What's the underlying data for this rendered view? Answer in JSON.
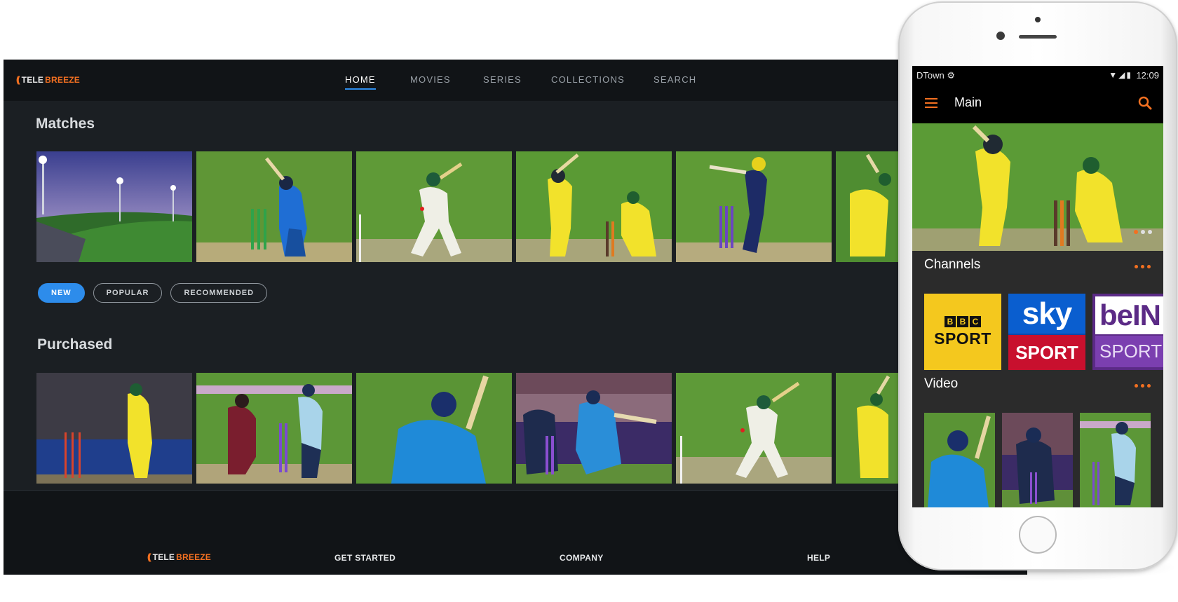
{
  "desktop": {
    "brand": {
      "wave": "((",
      "tele": "TELE",
      "breeze": "BREEZE"
    },
    "nav": [
      {
        "label": "HOME",
        "active": true
      },
      {
        "label": "MOVIES",
        "active": false
      },
      {
        "label": "SERIES",
        "active": false
      },
      {
        "label": "COLLECTIONS",
        "active": false
      },
      {
        "label": "SEARCH",
        "active": false
      }
    ],
    "sections": {
      "matches": "Matches",
      "purchased": "Purchased"
    },
    "filters": [
      {
        "label": "NEW",
        "active": true
      },
      {
        "label": "POPULAR",
        "active": false
      },
      {
        "label": "RECOMMENDED",
        "active": false
      }
    ],
    "footer": {
      "links": [
        "GET STARTED",
        "COMPANY",
        "HELP"
      ]
    },
    "colors": {
      "accent": "#2d8ceb",
      "brand": "#f37021",
      "background": "#1b1f23",
      "bar": "#111417"
    }
  },
  "phone": {
    "status": {
      "carrier": "DTown ⚙",
      "icons": "▼◢▮",
      "time": "12:09"
    },
    "appbar": {
      "title": "Main"
    },
    "sections": {
      "channels": "Channels",
      "video": "Video"
    },
    "channels": {
      "bbc": {
        "blocks": [
          "B",
          "B",
          "C"
        ],
        "word": "SPORT"
      },
      "sky": {
        "top": "sky",
        "bottom": "SPORT"
      },
      "bein": {
        "top": "beIN",
        "bottom": "SPORT"
      }
    },
    "hero_dots": 3,
    "hero_active_dot": 0
  }
}
